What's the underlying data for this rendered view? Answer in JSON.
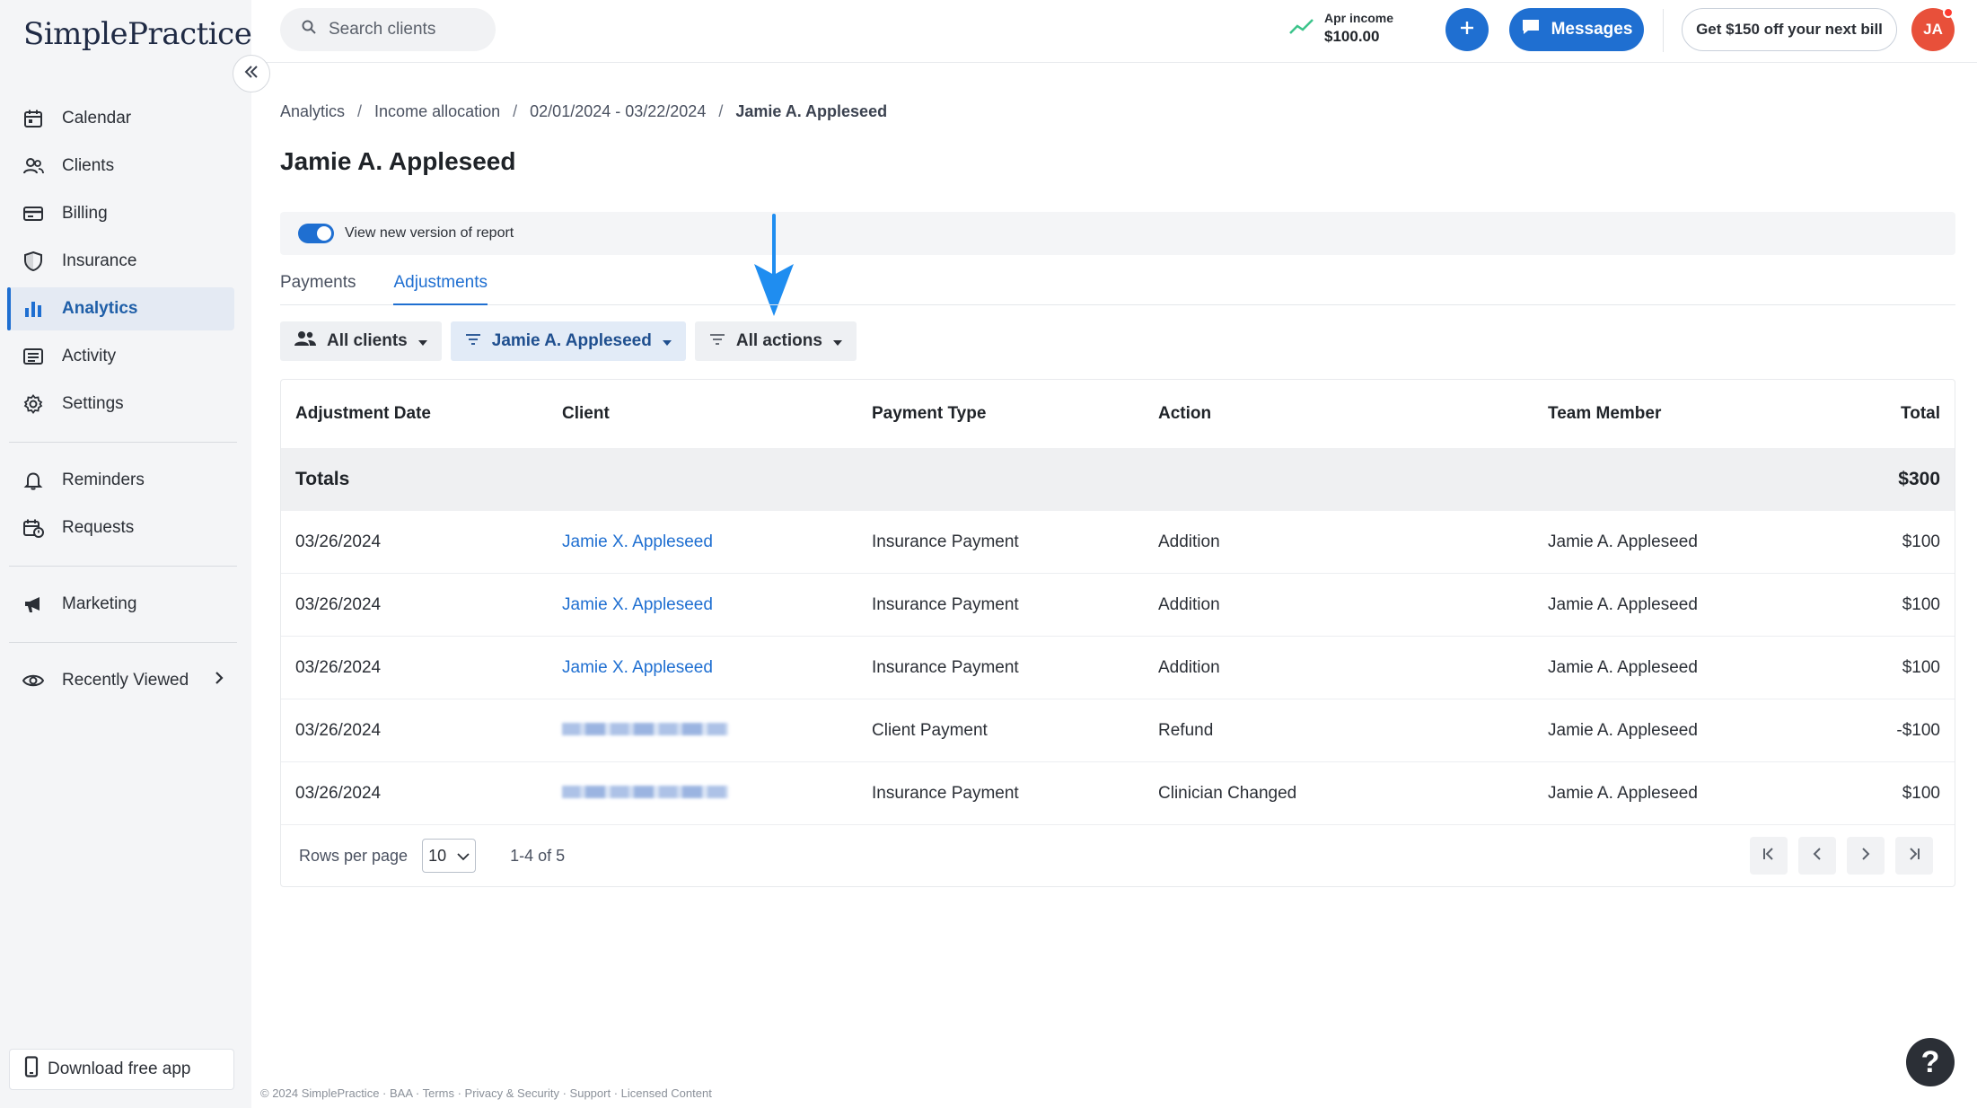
{
  "app": {
    "logo_text": "SimplePractice"
  },
  "sidebar": {
    "items": [
      {
        "label": "Calendar"
      },
      {
        "label": "Clients"
      },
      {
        "label": "Billing"
      },
      {
        "label": "Insurance"
      },
      {
        "label": "Analytics",
        "active": true
      },
      {
        "label": "Activity"
      },
      {
        "label": "Settings"
      },
      {
        "label": "Reminders"
      },
      {
        "label": "Requests"
      },
      {
        "label": "Marketing"
      },
      {
        "label": "Recently Viewed"
      }
    ],
    "download_label": "Download free app"
  },
  "header": {
    "search_placeholder": "Search clients",
    "income_label": "Apr income",
    "income_value": "$100.00",
    "messages_label": "Messages",
    "promo_label": "Get $150 off your next bill",
    "avatar_initials": "JA"
  },
  "breadcrumb": [
    "Analytics",
    "Income allocation",
    "02/01/2024 - 03/22/2024",
    "Jamie A. Appleseed"
  ],
  "page_title": "Jamie A. Appleseed",
  "toggle_label": "View new version of report",
  "tabs": [
    {
      "label": "Payments"
    },
    {
      "label": "Adjustments",
      "active": true
    }
  ],
  "filters": [
    {
      "label": "All clients"
    },
    {
      "label": "Jamie A. Appleseed"
    },
    {
      "label": "All actions"
    }
  ],
  "table": {
    "columns": [
      "Adjustment Date",
      "Client",
      "Payment Type",
      "Action",
      "Team Member",
      "Total"
    ],
    "totals_label": "Totals",
    "totals_value": "$300",
    "rows": [
      {
        "date": "03/26/2024",
        "client": "Jamie X. Appleseed",
        "payment_type": "Insurance Payment",
        "action": "Addition",
        "team_member": "Jamie A. Appleseed",
        "total": "$100"
      },
      {
        "date": "03/26/2024",
        "client": "Jamie X. Appleseed",
        "payment_type": "Insurance Payment",
        "action": "Addition",
        "team_member": "Jamie A. Appleseed",
        "total": "$100"
      },
      {
        "date": "03/26/2024",
        "client": "Jamie X. Appleseed",
        "payment_type": "Insurance Payment",
        "action": "Addition",
        "team_member": "Jamie A. Appleseed",
        "total": "$100"
      },
      {
        "date": "03/26/2024",
        "payment_type": "Client Payment",
        "action": "Refund",
        "team_member": "Jamie A. Appleseed",
        "total": "-$100"
      },
      {
        "date": "03/26/2024",
        "payment_type": "Insurance Payment",
        "action": "Clinician Changed",
        "team_member": "Jamie A. Appleseed",
        "total": "$100"
      }
    ]
  },
  "pagination": {
    "rows_label": "Rows per page",
    "rows_value": "10",
    "range": "1-4 of 5"
  },
  "footer": "© 2024 SimplePractice · BAA · Terms · Privacy & Security · Support · Licensed Content",
  "help_label": "?",
  "colors": {
    "accent": "#1f6fd1",
    "avatar": "#e8503a"
  }
}
